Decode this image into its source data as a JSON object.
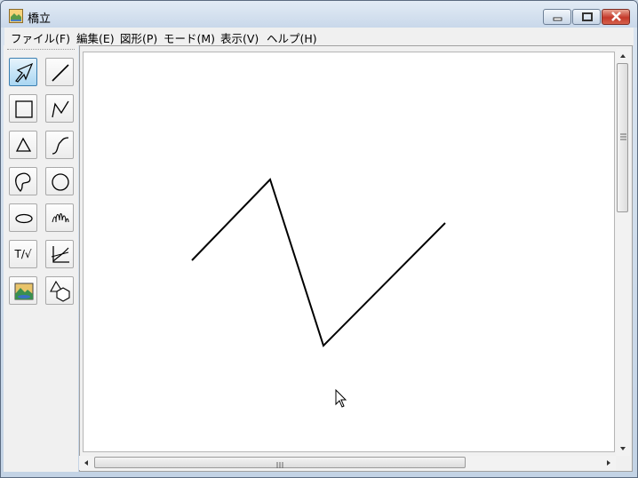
{
  "window": {
    "title": "橋立"
  },
  "menu": [
    {
      "label": "ファイル(F)"
    },
    {
      "label": "編集(E)"
    },
    {
      "label": "図形(P)"
    },
    {
      "label": "モード(M)"
    },
    {
      "label": "表示(V)"
    },
    {
      "label": "ヘルプ(H)"
    }
  ],
  "toolbox": {
    "tools": [
      {
        "name": "select-tool",
        "icon": "arrow-icon",
        "active": true
      },
      {
        "name": "line-tool",
        "icon": "line-icon"
      },
      {
        "name": "rectangle-tool",
        "icon": "square-icon"
      },
      {
        "name": "polyline-tool",
        "icon": "polyline-icon"
      },
      {
        "name": "polygon-tool",
        "icon": "triangle-icon"
      },
      {
        "name": "curve-tool",
        "icon": "curve-icon"
      },
      {
        "name": "freeform-tool",
        "icon": "blob-icon"
      },
      {
        "name": "circle-tool",
        "icon": "circle-icon"
      },
      {
        "name": "ellipse-tool",
        "icon": "ellipse-icon"
      },
      {
        "name": "spiral-tool",
        "icon": "spiral-icon"
      },
      {
        "name": "text-formula-tool",
        "label": "T/√",
        "icon": "text-formula-icon"
      },
      {
        "name": "graph-tool",
        "icon": "graph-icon"
      },
      {
        "name": "image-tool",
        "icon": "picture-icon"
      },
      {
        "name": "solid-shape-tool",
        "icon": "shapes-icon"
      }
    ]
  },
  "colors": {
    "close_button": "#c4392a",
    "active_tool": "#a9d6f2"
  }
}
